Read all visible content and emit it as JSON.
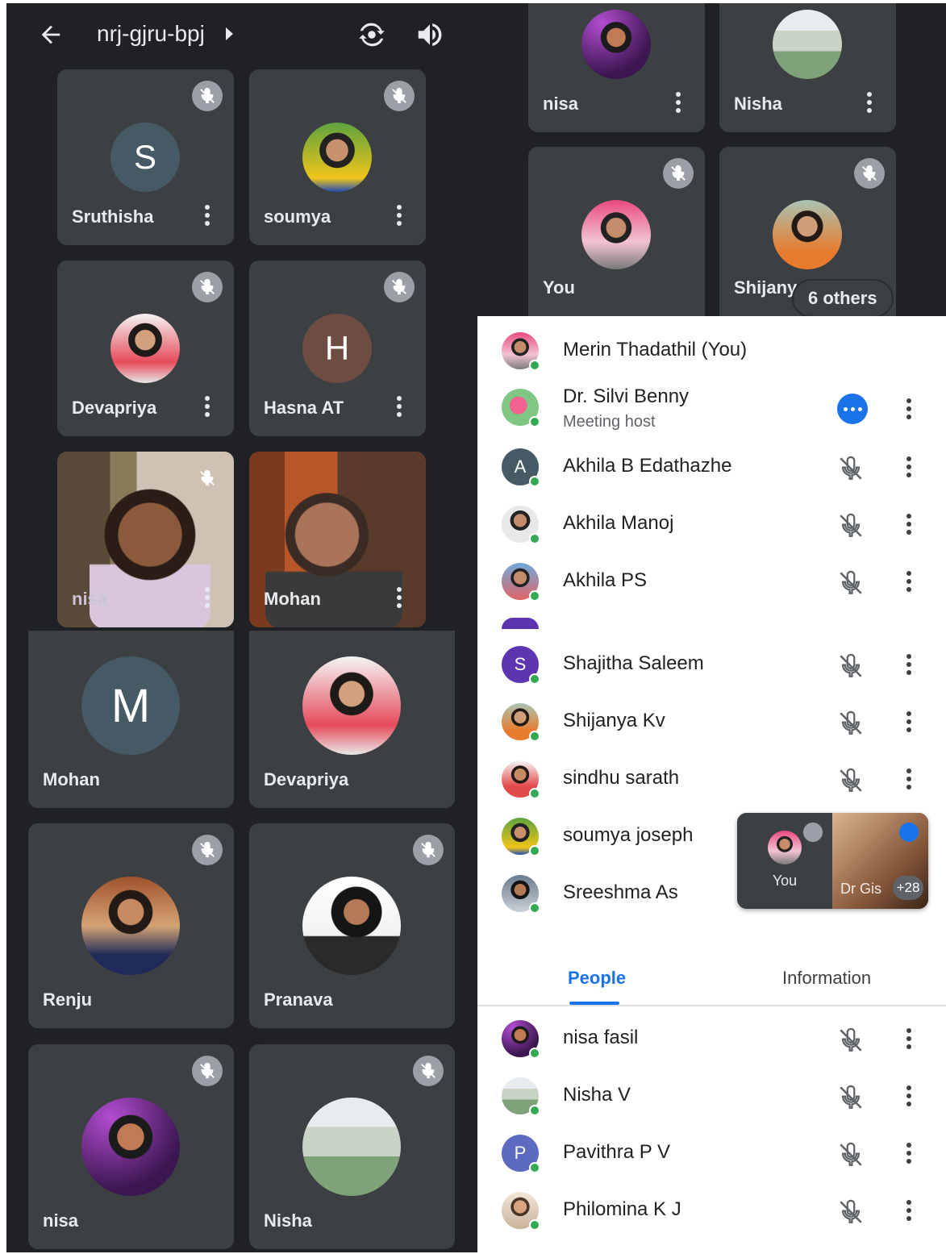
{
  "header": {
    "meeting_code": "nrj-gjru-bpj"
  },
  "grid_left": {
    "tiles": [
      {
        "name": "Sruthisha",
        "initial": "S"
      },
      {
        "name": "soumya"
      },
      {
        "name": "Devapriya"
      },
      {
        "name": "Hasna AT",
        "initial": "H"
      },
      {
        "name": "nisa"
      },
      {
        "name": "Mohan"
      },
      {
        "name": "Mohan",
        "initial": "M"
      },
      {
        "name": "Devapriya"
      },
      {
        "name": "Renju"
      },
      {
        "name": "Pranava"
      },
      {
        "name": "nisa"
      },
      {
        "name": "Nisha"
      }
    ]
  },
  "grid_right": {
    "tiles": [
      {
        "name": "nisa"
      },
      {
        "name": "Nisha"
      },
      {
        "name": "You"
      },
      {
        "name": "Shijanya"
      }
    ],
    "others_chip": "6 others"
  },
  "people": {
    "rows_top": [
      {
        "name": "Merin Thadathil (You)",
        "avatar": "photo"
      },
      {
        "name": "Dr. Silvi Benny",
        "sub": "Meeting host",
        "avatar": "photo"
      },
      {
        "name": "Akhila B Edathazhe",
        "initial": "A"
      },
      {
        "name": "Akhila Manoj",
        "avatar": "photo"
      },
      {
        "name": "Akhila PS",
        "avatar": "photo"
      }
    ],
    "rows_mid": [
      {
        "name": "Shajitha Saleem",
        "initial": "S"
      },
      {
        "name": "Shijanya Kv",
        "avatar": "photo"
      },
      {
        "name": "sindhu sarath",
        "avatar": "photo"
      },
      {
        "name": "soumya joseph",
        "avatar": "photo"
      },
      {
        "name": "Sreeshma As",
        "avatar": "photo"
      }
    ],
    "tabs": {
      "people": "People",
      "information": "Information"
    },
    "rows_bottom": [
      {
        "name": "nisa fasil",
        "avatar": "photo"
      },
      {
        "name": "Nisha V",
        "avatar": "photo"
      },
      {
        "name": "Pavithra P V",
        "initial": "P"
      },
      {
        "name": "Philomina K J",
        "avatar": "photo"
      }
    ]
  },
  "pip": {
    "you_label": "You",
    "other_name": "Dr Gis",
    "badge": "+28"
  },
  "colors": {
    "accent_blue": "#1a73e8",
    "tile_bg": "#3c4043",
    "dark_bg": "#202124",
    "online_green": "#34a853"
  }
}
